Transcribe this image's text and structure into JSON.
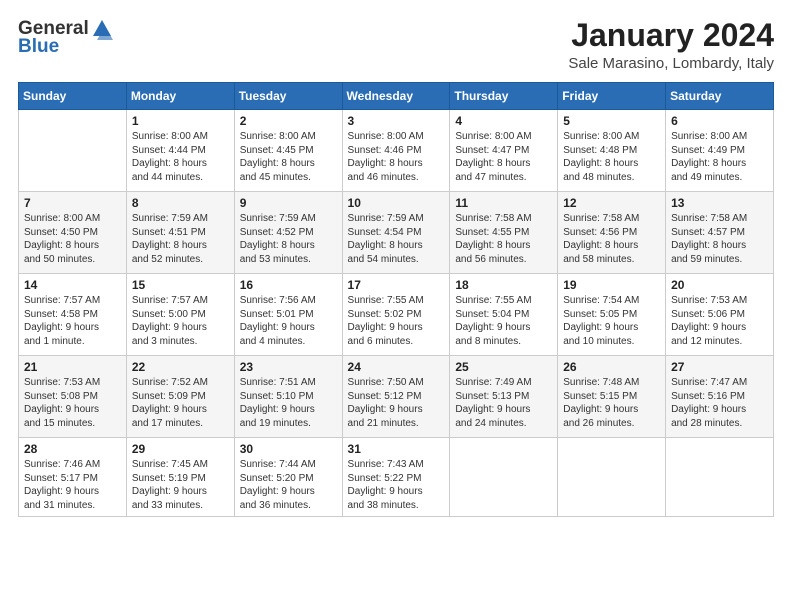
{
  "logo": {
    "general": "General",
    "blue": "Blue"
  },
  "header": {
    "month": "January 2024",
    "location": "Sale Marasino, Lombardy, Italy"
  },
  "weekdays": [
    "Sunday",
    "Monday",
    "Tuesday",
    "Wednesday",
    "Thursday",
    "Friday",
    "Saturday"
  ],
  "weeks": [
    [
      {
        "day": "",
        "info": ""
      },
      {
        "day": "1",
        "info": "Sunrise: 8:00 AM\nSunset: 4:44 PM\nDaylight: 8 hours\nand 44 minutes."
      },
      {
        "day": "2",
        "info": "Sunrise: 8:00 AM\nSunset: 4:45 PM\nDaylight: 8 hours\nand 45 minutes."
      },
      {
        "day": "3",
        "info": "Sunrise: 8:00 AM\nSunset: 4:46 PM\nDaylight: 8 hours\nand 46 minutes."
      },
      {
        "day": "4",
        "info": "Sunrise: 8:00 AM\nSunset: 4:47 PM\nDaylight: 8 hours\nand 47 minutes."
      },
      {
        "day": "5",
        "info": "Sunrise: 8:00 AM\nSunset: 4:48 PM\nDaylight: 8 hours\nand 48 minutes."
      },
      {
        "day": "6",
        "info": "Sunrise: 8:00 AM\nSunset: 4:49 PM\nDaylight: 8 hours\nand 49 minutes."
      }
    ],
    [
      {
        "day": "7",
        "info": "Sunrise: 8:00 AM\nSunset: 4:50 PM\nDaylight: 8 hours\nand 50 minutes."
      },
      {
        "day": "8",
        "info": "Sunrise: 7:59 AM\nSunset: 4:51 PM\nDaylight: 8 hours\nand 52 minutes."
      },
      {
        "day": "9",
        "info": "Sunrise: 7:59 AM\nSunset: 4:52 PM\nDaylight: 8 hours\nand 53 minutes."
      },
      {
        "day": "10",
        "info": "Sunrise: 7:59 AM\nSunset: 4:54 PM\nDaylight: 8 hours\nand 54 minutes."
      },
      {
        "day": "11",
        "info": "Sunrise: 7:58 AM\nSunset: 4:55 PM\nDaylight: 8 hours\nand 56 minutes."
      },
      {
        "day": "12",
        "info": "Sunrise: 7:58 AM\nSunset: 4:56 PM\nDaylight: 8 hours\nand 58 minutes."
      },
      {
        "day": "13",
        "info": "Sunrise: 7:58 AM\nSunset: 4:57 PM\nDaylight: 8 hours\nand 59 minutes."
      }
    ],
    [
      {
        "day": "14",
        "info": "Sunrise: 7:57 AM\nSunset: 4:58 PM\nDaylight: 9 hours\nand 1 minute."
      },
      {
        "day": "15",
        "info": "Sunrise: 7:57 AM\nSunset: 5:00 PM\nDaylight: 9 hours\nand 3 minutes."
      },
      {
        "day": "16",
        "info": "Sunrise: 7:56 AM\nSunset: 5:01 PM\nDaylight: 9 hours\nand 4 minutes."
      },
      {
        "day": "17",
        "info": "Sunrise: 7:55 AM\nSunset: 5:02 PM\nDaylight: 9 hours\nand 6 minutes."
      },
      {
        "day": "18",
        "info": "Sunrise: 7:55 AM\nSunset: 5:04 PM\nDaylight: 9 hours\nand 8 minutes."
      },
      {
        "day": "19",
        "info": "Sunrise: 7:54 AM\nSunset: 5:05 PM\nDaylight: 9 hours\nand 10 minutes."
      },
      {
        "day": "20",
        "info": "Sunrise: 7:53 AM\nSunset: 5:06 PM\nDaylight: 9 hours\nand 12 minutes."
      }
    ],
    [
      {
        "day": "21",
        "info": "Sunrise: 7:53 AM\nSunset: 5:08 PM\nDaylight: 9 hours\nand 15 minutes."
      },
      {
        "day": "22",
        "info": "Sunrise: 7:52 AM\nSunset: 5:09 PM\nDaylight: 9 hours\nand 17 minutes."
      },
      {
        "day": "23",
        "info": "Sunrise: 7:51 AM\nSunset: 5:10 PM\nDaylight: 9 hours\nand 19 minutes."
      },
      {
        "day": "24",
        "info": "Sunrise: 7:50 AM\nSunset: 5:12 PM\nDaylight: 9 hours\nand 21 minutes."
      },
      {
        "day": "25",
        "info": "Sunrise: 7:49 AM\nSunset: 5:13 PM\nDaylight: 9 hours\nand 24 minutes."
      },
      {
        "day": "26",
        "info": "Sunrise: 7:48 AM\nSunset: 5:15 PM\nDaylight: 9 hours\nand 26 minutes."
      },
      {
        "day": "27",
        "info": "Sunrise: 7:47 AM\nSunset: 5:16 PM\nDaylight: 9 hours\nand 28 minutes."
      }
    ],
    [
      {
        "day": "28",
        "info": "Sunrise: 7:46 AM\nSunset: 5:17 PM\nDaylight: 9 hours\nand 31 minutes."
      },
      {
        "day": "29",
        "info": "Sunrise: 7:45 AM\nSunset: 5:19 PM\nDaylight: 9 hours\nand 33 minutes."
      },
      {
        "day": "30",
        "info": "Sunrise: 7:44 AM\nSunset: 5:20 PM\nDaylight: 9 hours\nand 36 minutes."
      },
      {
        "day": "31",
        "info": "Sunrise: 7:43 AM\nSunset: 5:22 PM\nDaylight: 9 hours\nand 38 minutes."
      },
      {
        "day": "",
        "info": ""
      },
      {
        "day": "",
        "info": ""
      },
      {
        "day": "",
        "info": ""
      }
    ]
  ]
}
